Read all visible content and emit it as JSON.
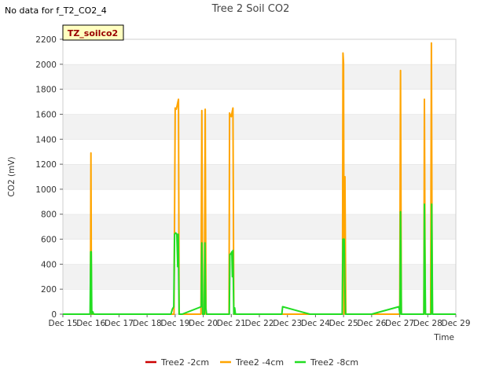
{
  "nodata_text": "No data for f_T2_CO2_4",
  "chart_data": {
    "type": "line",
    "title": "Tree 2 Soil CO2",
    "xlabel": "Time",
    "ylabel": "CO2 (mV)",
    "badge": "TZ_soilco2",
    "ylim": [
      0,
      2200
    ],
    "yticks": [
      0,
      200,
      400,
      600,
      800,
      1000,
      1200,
      1400,
      1600,
      1800,
      2000,
      2200
    ],
    "xlim": [
      0,
      14
    ],
    "xticks": [
      0,
      1,
      2,
      3,
      4,
      5,
      6,
      7,
      8,
      9,
      10,
      11,
      12,
      13,
      14
    ],
    "xtick_labels": [
      "Dec 15",
      "Dec 16",
      "Dec 17",
      "Dec 18",
      "Dec 19",
      "Dec 20",
      "Dec 21",
      "Dec 22",
      "Dec 23",
      "Dec 24",
      "Dec 25",
      "Dec 26",
      "Dec 27",
      "Dec 28",
      "Dec 29"
    ],
    "legend_position": "bottom-center",
    "grid": "horizontal bands",
    "colors": {
      "Tree2 -2cm": "#cc0000",
      "Tree2 -4cm": "#ffa500",
      "Tree2 -8cm": "#22dd22"
    },
    "series": [
      {
        "name": "Tree2 -2cm",
        "points": []
      },
      {
        "name": "Tree2 -4cm",
        "points": [
          [
            0.98,
            0
          ],
          [
            1.0,
            1290
          ],
          [
            1.02,
            0
          ],
          [
            1.06,
            0
          ],
          [
            3.96,
            0
          ],
          [
            4.0,
            1650
          ],
          [
            4.04,
            1640
          ],
          [
            4.07,
            1670
          ],
          [
            4.1,
            1700
          ],
          [
            4.12,
            1720
          ],
          [
            4.14,
            0
          ],
          [
            4.92,
            0
          ],
          [
            4.95,
            1630
          ],
          [
            4.98,
            0
          ],
          [
            5.04,
            0
          ],
          [
            5.07,
            1640
          ],
          [
            5.1,
            0
          ],
          [
            5.92,
            0
          ],
          [
            5.94,
            1610
          ],
          [
            5.97,
            1590
          ],
          [
            6.0,
            1580
          ],
          [
            6.03,
            1620
          ],
          [
            6.06,
            1650
          ],
          [
            6.09,
            0
          ],
          [
            9.96,
            0
          ],
          [
            9.98,
            2090
          ],
          [
            10.0,
            2010
          ],
          [
            10.02,
            0
          ],
          [
            10.05,
            1100
          ],
          [
            10.08,
            0
          ],
          [
            12.0,
            0
          ],
          [
            12.03,
            1950
          ],
          [
            12.06,
            0
          ],
          [
            12.86,
            0
          ],
          [
            12.88,
            1720
          ],
          [
            12.91,
            0
          ],
          [
            13.1,
            0
          ],
          [
            13.13,
            2170
          ],
          [
            13.16,
            0
          ]
        ]
      },
      {
        "name": "Tree2 -8cm",
        "points": [
          [
            0.0,
            0
          ],
          [
            0.97,
            0
          ],
          [
            0.99,
            500
          ],
          [
            1.01,
            500
          ],
          [
            1.03,
            0
          ],
          [
            1.06,
            20
          ],
          [
            1.1,
            0
          ],
          [
            3.85,
            0
          ],
          [
            3.9,
            40
          ],
          [
            3.95,
            60
          ],
          [
            3.98,
            640
          ],
          [
            4.02,
            650
          ],
          [
            4.06,
            640
          ],
          [
            4.09,
            380
          ],
          [
            4.11,
            640
          ],
          [
            4.14,
            0
          ],
          [
            4.25,
            0
          ],
          [
            4.93,
            60
          ],
          [
            4.95,
            570
          ],
          [
            4.98,
            0
          ],
          [
            5.04,
            0
          ],
          [
            5.06,
            570
          ],
          [
            5.09,
            50
          ],
          [
            5.12,
            0
          ],
          [
            5.16,
            0
          ],
          [
            5.93,
            0
          ],
          [
            5.95,
            480
          ],
          [
            5.98,
            480
          ],
          [
            6.02,
            500
          ],
          [
            6.04,
            300
          ],
          [
            6.06,
            510
          ],
          [
            6.09,
            0
          ],
          [
            6.12,
            50
          ],
          [
            6.15,
            0
          ],
          [
            7.8,
            0
          ],
          [
            7.83,
            60
          ],
          [
            8.8,
            0
          ],
          [
            9.95,
            0
          ],
          [
            9.98,
            600
          ],
          [
            10.02,
            600
          ],
          [
            10.04,
            300
          ],
          [
            10.07,
            0
          ],
          [
            11.0,
            0
          ],
          [
            11.97,
            60
          ],
          [
            12.01,
            0
          ],
          [
            12.03,
            820
          ],
          [
            12.06,
            0
          ],
          [
            12.86,
            0
          ],
          [
            12.88,
            880
          ],
          [
            12.92,
            0
          ],
          [
            13.12,
            0
          ],
          [
            13.14,
            880
          ],
          [
            13.17,
            0
          ],
          [
            14.0,
            0
          ]
        ]
      }
    ]
  }
}
